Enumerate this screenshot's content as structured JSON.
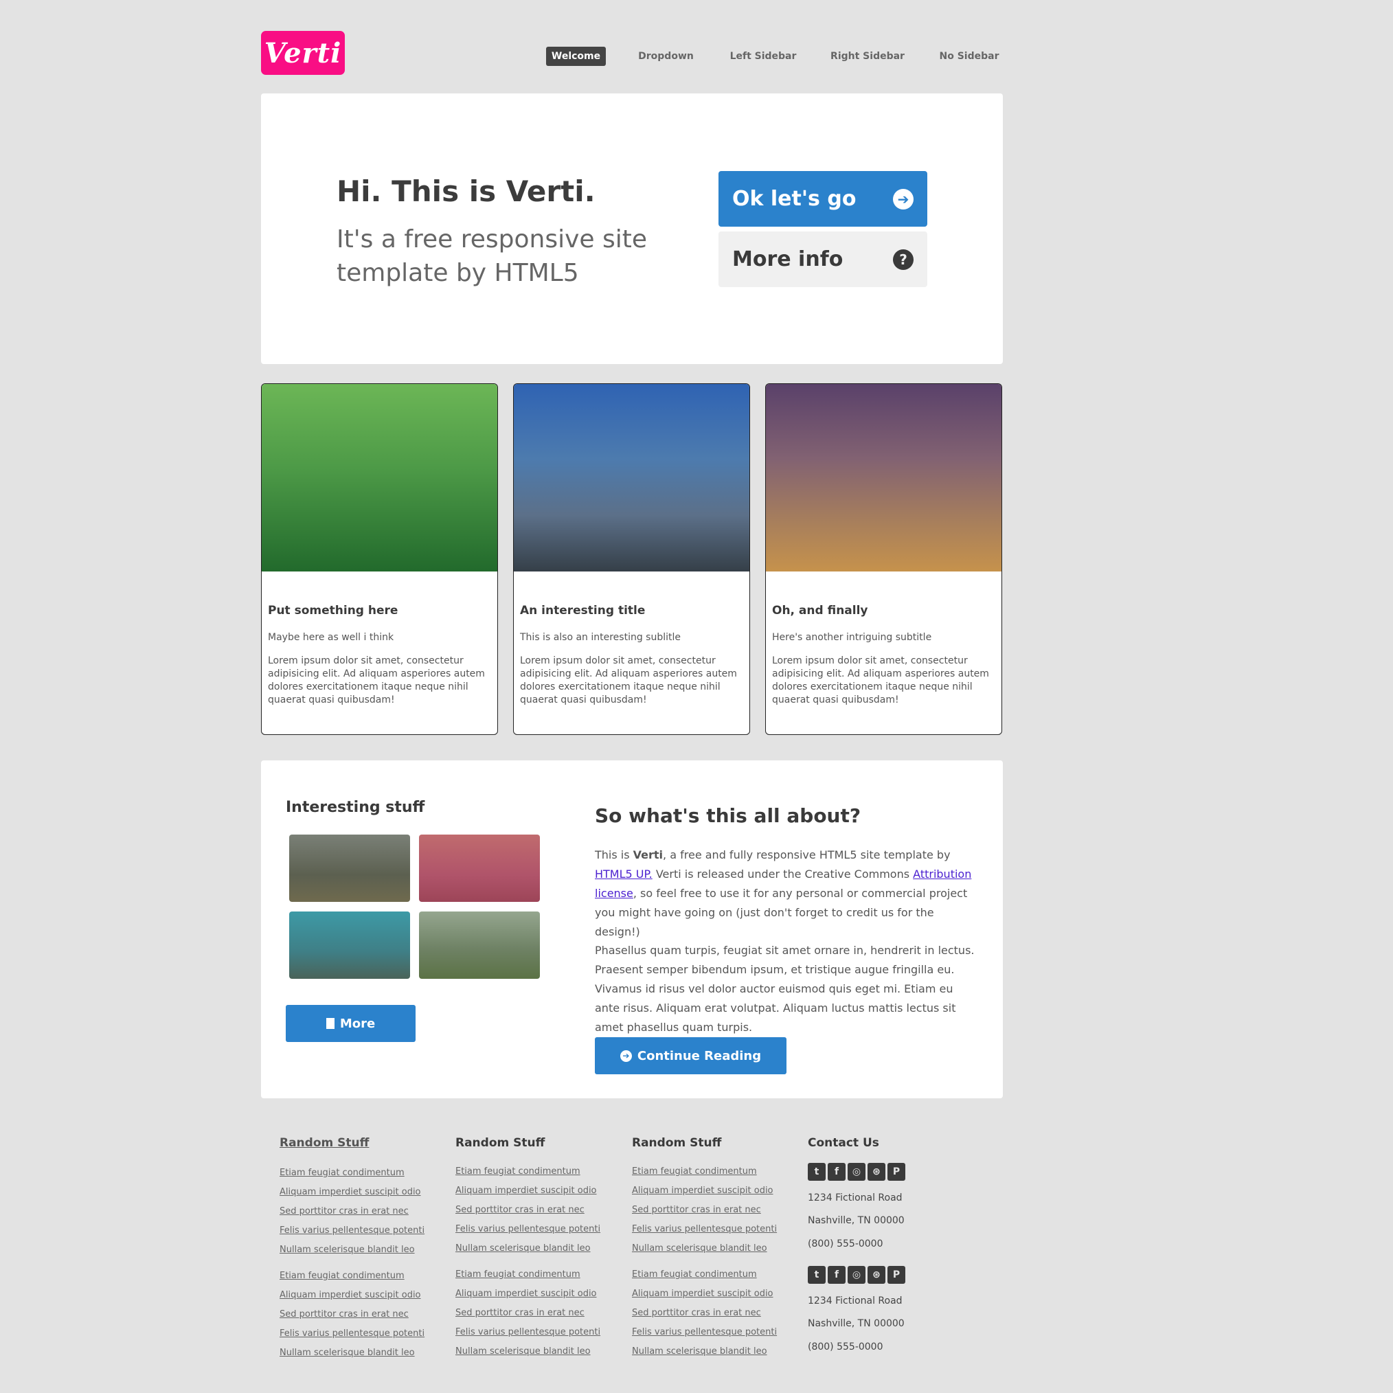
{
  "header": {
    "logo": "Verti",
    "nav": [
      "Welcome",
      "Dropdown",
      "Left Sidebar",
      "Right Sidebar",
      "No Sidebar"
    ]
  },
  "banner": {
    "title": "Hi. This is Verti.",
    "subtitle": "It's a free responsive site template by HTML5",
    "primary_button": "Ok let's go",
    "secondary_button": "More info"
  },
  "cards": [
    {
      "title": "Put something here",
      "subtitle": "Maybe here as well i think",
      "body": "Lorem ipsum dolor sit amet, consectetur adipisicing elit. Ad aliquam asperiores autem dolores exercitationem itaque neque nihil quaerat quasi quibusdam!"
    },
    {
      "title": "An interesting title",
      "subtitle": "This is also an interesting sublitle",
      "body": "Lorem ipsum dolor sit amet, consectetur adipisicing elit. Ad aliquam asperiores autem dolores exercitationem itaque neque nihil quaerat quasi quibusdam!"
    },
    {
      "title": "Oh, and finally",
      "subtitle": "Here's another intriguing subtitle",
      "body": "Lorem ipsum dolor sit amet, consectetur adipisicing elit. Ad aliquam asperiores autem dolores exercitationem itaque neque nihil quaerat quasi quibusdam!"
    }
  ],
  "content": {
    "sidebar_title": "Interesting stuff",
    "more_button": "More",
    "about_title": "So what's this all about?",
    "about_p1_a": "This is ",
    "about_p1_b": "Verti",
    "about_p1_c": ", a free and fully responsive HTML5 site template by ",
    "about_p1_link1": "HTML5 UP.",
    "about_p1_d": " Verti is released under the Creative Commons ",
    "about_p1_link2": "Attribution license",
    "about_p1_e": ", so feel free to use it for any personal or commercial project you might have going on (just don't forget to credit us for the design!)",
    "about_p2": "Phasellus quam turpis, feugiat sit amet ornare in, hendrerit in lectus. Praesent semper bibendum ipsum, et tristique augue fringilla eu. Vivamus id risus vel dolor auctor euismod quis eget mi. Etiam eu ante risus. Aliquam erat volutpat. Aliquam luctus mattis lectus sit amet phasellus quam turpis.",
    "continue_button": "Continue Reading"
  },
  "footer": {
    "columns": [
      {
        "heading": "Random Stuff"
      },
      {
        "heading": "Random Stuff"
      },
      {
        "heading": "Random Stuff"
      }
    ],
    "links": [
      "Etiam feugiat condimentum",
      "Aliquam imperdiet suscipit odio",
      "Sed porttitor cras in erat nec",
      "Felis varius pellentesque potenti",
      "Nullam scelerisque blandit leo"
    ],
    "contact_heading": "Contact Us",
    "address_line1": "1234 Fictional Road",
    "address_line2": "Nashville, TN 00000",
    "phone": "(800) 555-0000"
  },
  "colors": {
    "brand": "#f90e84",
    "accent": "#2b82cc",
    "background": "#e3e3e3"
  }
}
